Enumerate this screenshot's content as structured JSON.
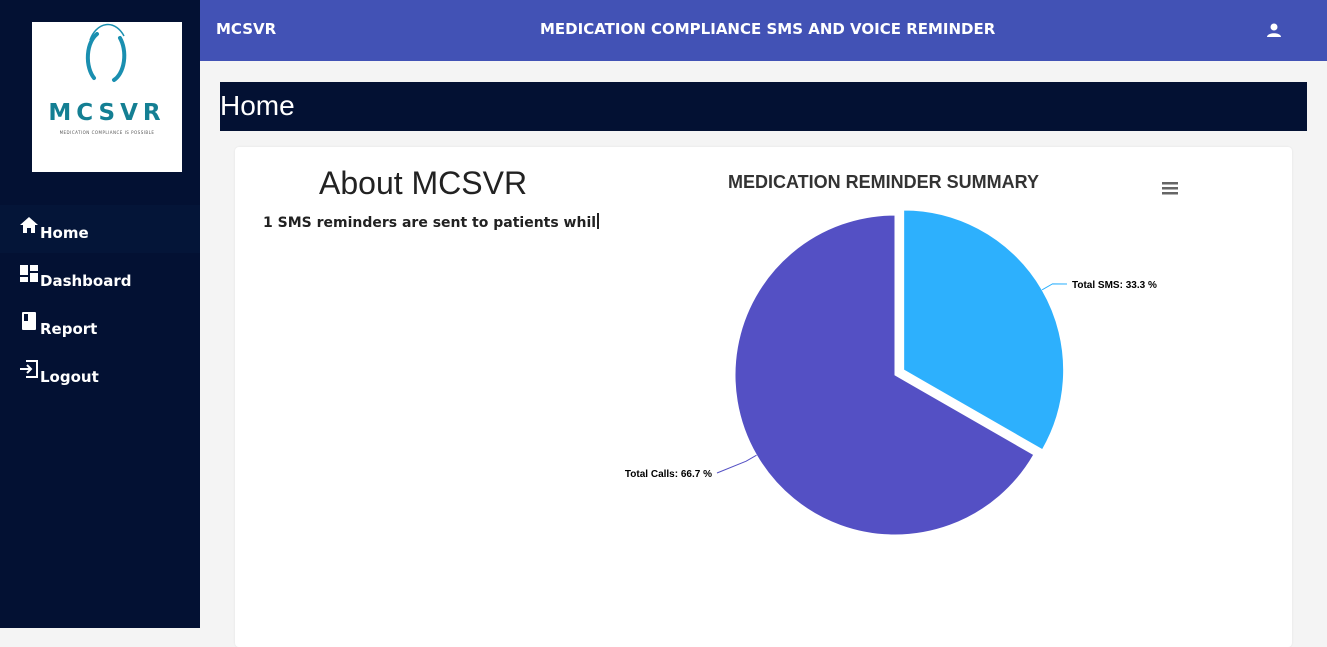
{
  "sidebar": {
    "logo": {
      "text": "MCSVR",
      "tagline": "MEDICATION COMPLIANCE IS POSSIBLE"
    },
    "items": [
      {
        "label": "Home",
        "icon": "home-icon"
      },
      {
        "label": "Dashboard",
        "icon": "dashboard-icon"
      },
      {
        "label": "Report",
        "icon": "report-icon"
      },
      {
        "label": "Logout",
        "icon": "logout-icon"
      }
    ]
  },
  "header": {
    "brand": "MCSVR",
    "title": "MEDICATION COMPLIANCE SMS AND VOICE REMINDER",
    "user_icon": "user-icon"
  },
  "page": {
    "title": "Home"
  },
  "about": {
    "title": "About MCSVR",
    "text": "1 SMS reminders are sent to patients whil"
  },
  "colors": {
    "sidebar_bg": "#031133",
    "topbar_bg": "#4252b5",
    "sms_slice": "#2db0fd",
    "calls_slice": "#5450c4"
  },
  "chart_data": {
    "type": "pie",
    "title": "MEDICATION REMINDER SUMMARY",
    "slices": [
      {
        "name": "Total SMS",
        "value": 33.3,
        "label": "Total SMS: 33.3 %",
        "color": "#2db0fd"
      },
      {
        "name": "Total Calls",
        "value": 66.7,
        "label": "Total Calls: 66.7 %",
        "color": "#5450c4"
      }
    ]
  }
}
